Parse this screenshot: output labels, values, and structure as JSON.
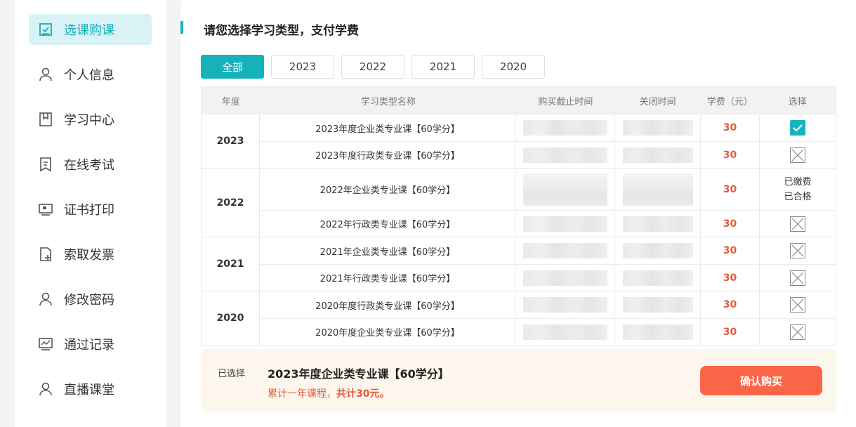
{
  "sidebar": {
    "items": [
      {
        "label": "选课购课",
        "icon": "course-select-icon",
        "active": true
      },
      {
        "label": "个人信息",
        "icon": "user-icon"
      },
      {
        "label": "学习中心",
        "icon": "bookmark-icon"
      },
      {
        "label": "在线考试",
        "icon": "exam-icon"
      },
      {
        "label": "证书打印",
        "icon": "certificate-print-icon"
      },
      {
        "label": "索取发票",
        "icon": "invoice-icon"
      },
      {
        "label": "修改密码",
        "icon": "user-icon"
      },
      {
        "label": "通过记录",
        "icon": "chart-monitor-icon"
      },
      {
        "label": "直播课堂",
        "icon": "user-icon"
      }
    ]
  },
  "main": {
    "title": "请您选择学习类型，支付学费",
    "tabs": [
      "全部",
      "2023",
      "2022",
      "2021",
      "2020"
    ],
    "active_tab": "全部",
    "table": {
      "headers": {
        "year": "年度",
        "name": "学习类型名称",
        "buy_deadline": "购买截止时间",
        "close_time": "关闭时间",
        "fee": "学费（元）",
        "select": "选择"
      },
      "groups": [
        {
          "year": "2023",
          "rows": [
            {
              "name": "2023年度企业类专业课【60学分】",
              "fee": "30",
              "state": "checked"
            },
            {
              "name": "2023年度行政类专业课【60学分】",
              "fee": "30",
              "state": "unavailable"
            }
          ]
        },
        {
          "year": "2022",
          "rows": [
            {
              "name": "2022年企业类专业课【60学分】",
              "fee": "30",
              "state": "status",
              "status_lines": [
                "已缴费",
                "已合格"
              ]
            },
            {
              "name": "2022年行政类专业课【60学分】",
              "fee": "30",
              "state": "unavailable"
            }
          ]
        },
        {
          "year": "2021",
          "rows": [
            {
              "name": "2021年企业类专业课【60学分】",
              "fee": "30",
              "state": "unavailable"
            },
            {
              "name": "2021年行政类专业课【60学分】",
              "fee": "30",
              "state": "unavailable"
            }
          ]
        },
        {
          "year": "2020",
          "rows": [
            {
              "name": "2020年度行政类专业课【60学分】",
              "fee": "30",
              "state": "unavailable"
            },
            {
              "name": "2020年度企业类专业课【60学分】",
              "fee": "30",
              "state": "unavailable"
            }
          ]
        }
      ]
    }
  },
  "footer": {
    "selected_label": "已选择",
    "selected_course": "2023年度企业类专业课【60学分】",
    "summary_prefix": "累计一年课程，",
    "summary_total": "共计30元。",
    "confirm_label": "确认购买"
  },
  "colors": {
    "accent": "#16b2bc",
    "fee": "#e35a3a",
    "confirm": "#fa6548",
    "footer_bg": "#fdf6ec"
  }
}
